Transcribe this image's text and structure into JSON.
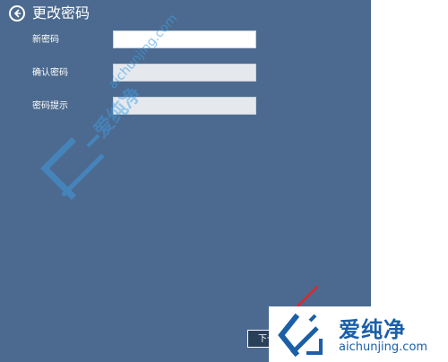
{
  "header": {
    "title": "更改密码"
  },
  "form": {
    "fields": [
      {
        "label": "新密码",
        "value": "",
        "placeholder": ""
      },
      {
        "label": "确认密码",
        "value": "",
        "placeholder": ""
      },
      {
        "label": "密码提示",
        "value": "",
        "placeholder": ""
      }
    ]
  },
  "actions": {
    "next_label": "下一"
  },
  "watermark": {
    "brand_cn": "爱纯净",
    "brand_url": "aichunjing.com"
  },
  "colors": {
    "panel_bg": "#4c6a8f",
    "brand_blue": "#1b5fa7",
    "arrow_red": "#e0262a"
  },
  "icons": {
    "back": "back-arrow-icon",
    "logo": "aichunjing-logo-icon"
  }
}
